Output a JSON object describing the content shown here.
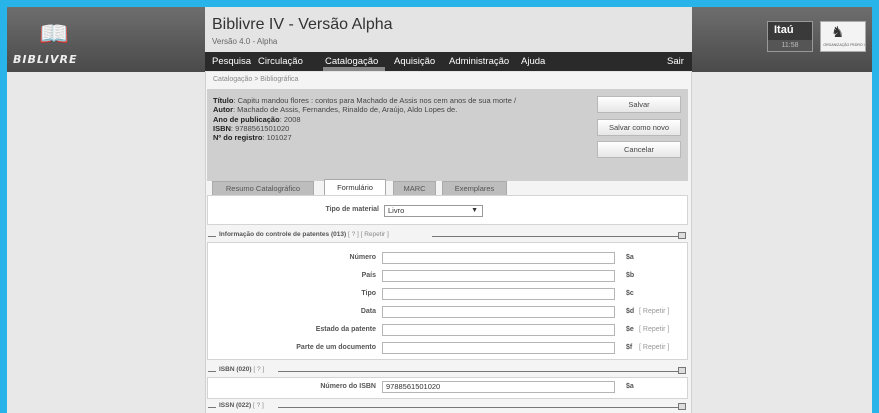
{
  "logo": {
    "text": "BIBLIVRE"
  },
  "app": {
    "title": "Biblivre IV - Versão Alpha",
    "version": "Versão 4.0 - Alpha"
  },
  "menu": {
    "items": [
      "Pesquisa",
      "Circulação",
      "Catalogação",
      "Aquisição",
      "Administração",
      "Ajuda"
    ],
    "logout": "Sair"
  },
  "sponsor": {
    "name": "Itaú",
    "time": "11:58"
  },
  "seal": {
    "caption": "ORGANIZAÇÃO PEDRO I"
  },
  "breadcrumb": "Catalogação > Bibliográfica",
  "record": {
    "titulo_label": "Título",
    "titulo": ": Capitu mandou flores : contos para Machado de Assis nos cem anos de sua morte /",
    "autor_label": "Autor",
    "autor": ": Machado de Assis, Fernandes, Rinaldo de, Araújo, Aldo Lopes de.",
    "ano_label": "Ano de publicação",
    "ano": ": 2008",
    "isbn_label": "ISBN",
    "isbn": ": 9788561501020",
    "registro_label": "Nº do registro",
    "registro": ": 101027"
  },
  "actions": {
    "save": "Salvar",
    "save_new": "Salvar como novo",
    "cancel": "Cancelar"
  },
  "tabs": [
    "Resumo Catalográfico",
    "Formulário",
    "MARC",
    "Exemplares"
  ],
  "active_tab": "Formulário",
  "material": {
    "label": "Tipo de material",
    "value": "Livro"
  },
  "sections": {
    "patent": {
      "title": "Informação do controle de patentes  (013)",
      "help": "[ ? ]",
      "repeat": "[ Repetir ]",
      "fields": [
        {
          "label": "Número",
          "sub": "$a",
          "repeat": ""
        },
        {
          "label": "País",
          "sub": "$b",
          "repeat": ""
        },
        {
          "label": "Tipo",
          "sub": "$c",
          "repeat": ""
        },
        {
          "label": "Data",
          "sub": "$d",
          "repeat": "[ Repetir ]"
        },
        {
          "label": "Estado da patente",
          "sub": "$e",
          "repeat": "[ Repetir ]"
        },
        {
          "label": "Parte de um documento",
          "sub": "$f",
          "repeat": "[ Repetir ]"
        }
      ]
    },
    "isbn": {
      "title": "ISBN  (020)",
      "help": "[ ? ]",
      "field": {
        "label": "Número do ISBN",
        "value": "9788561501020",
        "sub": "$a"
      }
    },
    "issn": {
      "title": "ISSN  (022)",
      "help": "[ ? ]"
    }
  },
  "colors": {
    "frame": "#28b4e8",
    "menu_bg": "#2a2a2a",
    "summary_bg": "#cfcfcf"
  }
}
